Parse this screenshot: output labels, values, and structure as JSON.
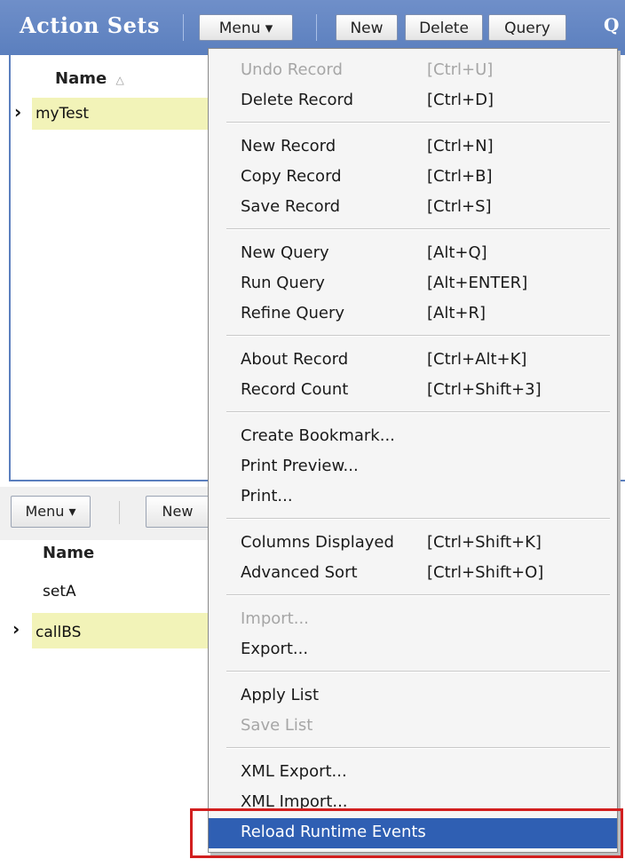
{
  "top_applet": {
    "title": "Action Sets",
    "toolbar": {
      "menu": "Menu ▾",
      "new": "New",
      "delete": "Delete",
      "query": "Query",
      "q_trunc": "Q"
    },
    "column": {
      "name": "Name",
      "sort_indicator": "△"
    },
    "rows": [
      {
        "name": "myTest",
        "selected": true,
        "marker": "›"
      }
    ]
  },
  "bottom_applet": {
    "toolbar": {
      "menu": "Menu ▾",
      "new": "New"
    },
    "column": {
      "name": "Name"
    },
    "rows": [
      {
        "name": "setA",
        "selected": false,
        "marker": ""
      },
      {
        "name": "callBS",
        "selected": true,
        "marker": "›"
      }
    ]
  },
  "menu": {
    "items": [
      {
        "label": "Undo Record",
        "shortcut": "[Ctrl+U]",
        "disabled": true
      },
      {
        "label": "Delete Record",
        "shortcut": "[Ctrl+D]"
      },
      {
        "label": "New Record",
        "shortcut": "[Ctrl+N]"
      },
      {
        "label": "Copy Record",
        "shortcut": "[Ctrl+B]"
      },
      {
        "label": "Save Record",
        "shortcut": "[Ctrl+S]"
      },
      {
        "label": "New Query",
        "shortcut": "[Alt+Q]"
      },
      {
        "label": "Run Query",
        "shortcut": "[Alt+ENTER]"
      },
      {
        "label": "Refine Query",
        "shortcut": "[Alt+R]"
      },
      {
        "label": "About Record",
        "shortcut": "[Ctrl+Alt+K]"
      },
      {
        "label": "Record Count",
        "shortcut": "[Ctrl+Shift+3]"
      },
      {
        "label": "Create Bookmark...",
        "shortcut": ""
      },
      {
        "label": "Print Preview...",
        "shortcut": ""
      },
      {
        "label": "Print...",
        "shortcut": ""
      },
      {
        "label": "Columns Displayed",
        "shortcut": "[Ctrl+Shift+K]"
      },
      {
        "label": "Advanced Sort",
        "shortcut": "[Ctrl+Shift+O]"
      },
      {
        "label": "Import...",
        "shortcut": "",
        "disabled": true
      },
      {
        "label": "Export...",
        "shortcut": ""
      },
      {
        "label": "Apply List",
        "shortcut": ""
      },
      {
        "label": "Save List",
        "shortcut": "",
        "disabled": true
      },
      {
        "label": "XML Export...",
        "shortcut": ""
      },
      {
        "label": "XML Import...",
        "shortcut": ""
      },
      {
        "label": "Reload Runtime Events",
        "shortcut": "",
        "highlighted": true
      }
    ]
  },
  "colors": {
    "header_blue": "#5b7fbe",
    "selected_row": "#f2f3b8",
    "menu_highlight": "#2f5fb3",
    "callout_red": "#d21f1f"
  }
}
